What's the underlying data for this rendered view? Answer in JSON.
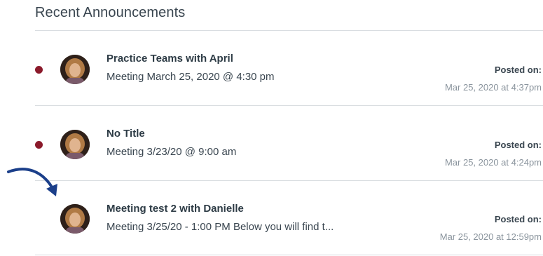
{
  "section": {
    "title": "Recent Announcements"
  },
  "announcements": [
    {
      "title": "Practice Teams with April",
      "preview": "Meeting March 25, 2020 @ 4:30 pm",
      "posted_label": "Posted on:",
      "posted_date": "Mar 25, 2020 at 4:37pm",
      "unread": true
    },
    {
      "title": "No Title",
      "preview": "Meeting 3/23/20 @ 9:00 am",
      "posted_label": "Posted on:",
      "posted_date": "Mar 25, 2020 at 4:24pm",
      "unread": true
    },
    {
      "title": "Meeting test 2 with Danielle",
      "preview": "Meeting 3/25/20 - 1:00 PM Below you will find t...",
      "posted_label": "Posted on:",
      "posted_date": "Mar 25, 2020 at 12:59pm",
      "unread": false
    }
  ],
  "colors": {
    "unread_dot": "#8b1a2b",
    "arrow": "#1b3f8a"
  },
  "icons": {
    "unread": "unread-dot-icon",
    "arrow": "arrow-pointer-icon",
    "avatar": "user-avatar-photo"
  }
}
